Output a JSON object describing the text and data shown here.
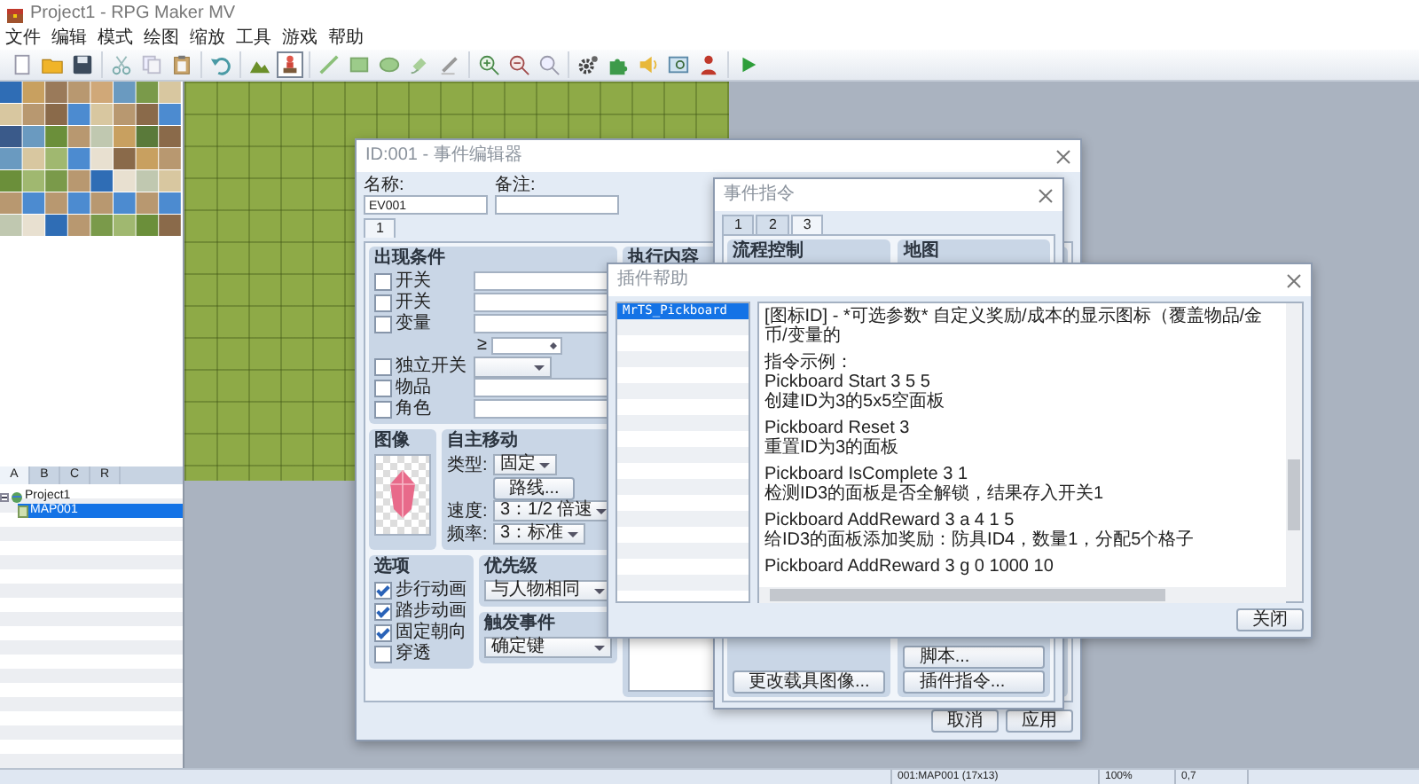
{
  "window": {
    "title": "Project1 - RPG Maker MV"
  },
  "menu": [
    "文件",
    "编辑",
    "模式",
    "绘图",
    "缩放",
    "工具",
    "游戏",
    "帮助"
  ],
  "toolbar": {
    "groups": [
      {
        "items": [
          {
            "kind": "new"
          },
          {
            "kind": "open"
          },
          {
            "kind": "save"
          }
        ]
      },
      {
        "items": [
          {
            "kind": "cut"
          },
          {
            "kind": "copy"
          },
          {
            "kind": "paste"
          }
        ]
      },
      {
        "items": [
          {
            "kind": "undo"
          }
        ]
      },
      {
        "items": [
          {
            "kind": "map",
            "selected": false
          },
          {
            "kind": "event",
            "selected": true
          }
        ]
      },
      {
        "items": [
          {
            "kind": "pencil"
          },
          {
            "kind": "rect"
          },
          {
            "kind": "ellipse"
          },
          {
            "kind": "fill"
          },
          {
            "kind": "shadow"
          }
        ]
      },
      {
        "items": [
          {
            "kind": "zoom-in"
          },
          {
            "kind": "zoom-out"
          },
          {
            "kind": "zoom-actual"
          }
        ]
      },
      {
        "items": [
          {
            "kind": "database"
          },
          {
            "kind": "plugins"
          },
          {
            "kind": "sound"
          },
          {
            "kind": "resources"
          },
          {
            "kind": "character"
          }
        ]
      },
      {
        "items": [
          {
            "kind": "play"
          }
        ]
      }
    ]
  },
  "tileset_tabs": [
    {
      "label": "A",
      "selected": true
    },
    {
      "label": "B",
      "selected": false
    },
    {
      "label": "C",
      "selected": false
    },
    {
      "label": "R",
      "selected": false
    }
  ],
  "map_tree": [
    {
      "label": "Project1",
      "selected": false,
      "expanded": true,
      "children": [
        {
          "label": "MAP001",
          "selected": true
        }
      ]
    }
  ],
  "status_bar": [
    "001:MAP001 (17x13)",
    "100%",
    "0,7"
  ],
  "event_editor": {
    "title": "ID:001 - 事件编辑器",
    "name_label": "名称:",
    "name": "EV001",
    "note_label": "备注:",
    "tabs": [
      {
        "label": "1",
        "selected": true
      }
    ],
    "conditions": {
      "title": "出现条件",
      "rows": [
        {
          "kind": "field",
          "label": "开关",
          "checked": false
        },
        {
          "kind": "field",
          "label": "开关",
          "checked": false
        },
        {
          "kind": "field",
          "label": "变量",
          "checked": false
        },
        {
          "kind": "compare",
          "symbol": "≥"
        },
        {
          "kind": "select",
          "label": "独立开关",
          "checked": false
        },
        {
          "kind": "field",
          "label": "物品",
          "checked": false
        },
        {
          "kind": "field",
          "label": "角色",
          "checked": false
        }
      ]
    },
    "image": {
      "title": "图像"
    },
    "movement": {
      "title": "自主移动",
      "type_label": "类型:",
      "type": "固定",
      "route_button": "路线...",
      "speed_label": "速度:",
      "speed": "3：1/2 倍速",
      "frequency_label": "频率:",
      "frequency": "3：标准"
    },
    "options": {
      "title": "选项",
      "items": [
        {
          "label": "步行动画",
          "checked": true
        },
        {
          "label": "踏步动画",
          "checked": true
        },
        {
          "label": "固定朝向",
          "checked": true
        },
        {
          "label": "穿透",
          "checked": false
        }
      ]
    },
    "priority": {
      "title": "优先级",
      "value": "与人物相同"
    },
    "trigger": {
      "title": "触发事件",
      "value": "确定键"
    },
    "contents": {
      "title": "执行内容"
    },
    "buttons": [
      "取消",
      "应用"
    ]
  },
  "event_commands": {
    "title": "事件指令",
    "tabs": [
      {
        "label": "1",
        "selected": false
      },
      {
        "label": "2",
        "selected": false
      },
      {
        "label": "3",
        "selected": true
      }
    ],
    "columns": [
      {
        "header": "流程控制",
        "buttons": [
          "更改载具图像..."
        ]
      },
      {
        "header": "地图",
        "buttons": [
          "脚本...",
          "插件指令..."
        ]
      }
    ]
  },
  "plugin_help": {
    "title": "插件帮助",
    "plugins": [
      {
        "label": "MrTS_Pickboard",
        "selected": true
      }
    ],
    "paragraphs": [
      {
        "lines": [
          "[图标ID] - *可选参数* 自定义奖励/成本的显示图标（覆盖物品/金币/变量的"
        ]
      },
      {
        "lines": [
          "指令示例：",
          "Pickboard Start 3 5 5",
          "创建ID为3的5x5空面板"
        ]
      },
      {
        "lines": [
          "Pickboard Reset 3",
          "重置ID为3的面板"
        ]
      },
      {
        "lines": [
          "Pickboard IsComplete 3 1",
          "检测ID3的面板是否全解锁，结果存入开关1"
        ]
      },
      {
        "lines": [
          "Pickboard AddReward 3 a 4 1 5",
          "给ID3的面板添加奖励：防具ID4，数量1，分配5个格子"
        ]
      },
      {
        "lines": [
          "Pickboard AddReward 3 g 0 1000 10"
        ]
      }
    ],
    "close_button": "关闭"
  }
}
